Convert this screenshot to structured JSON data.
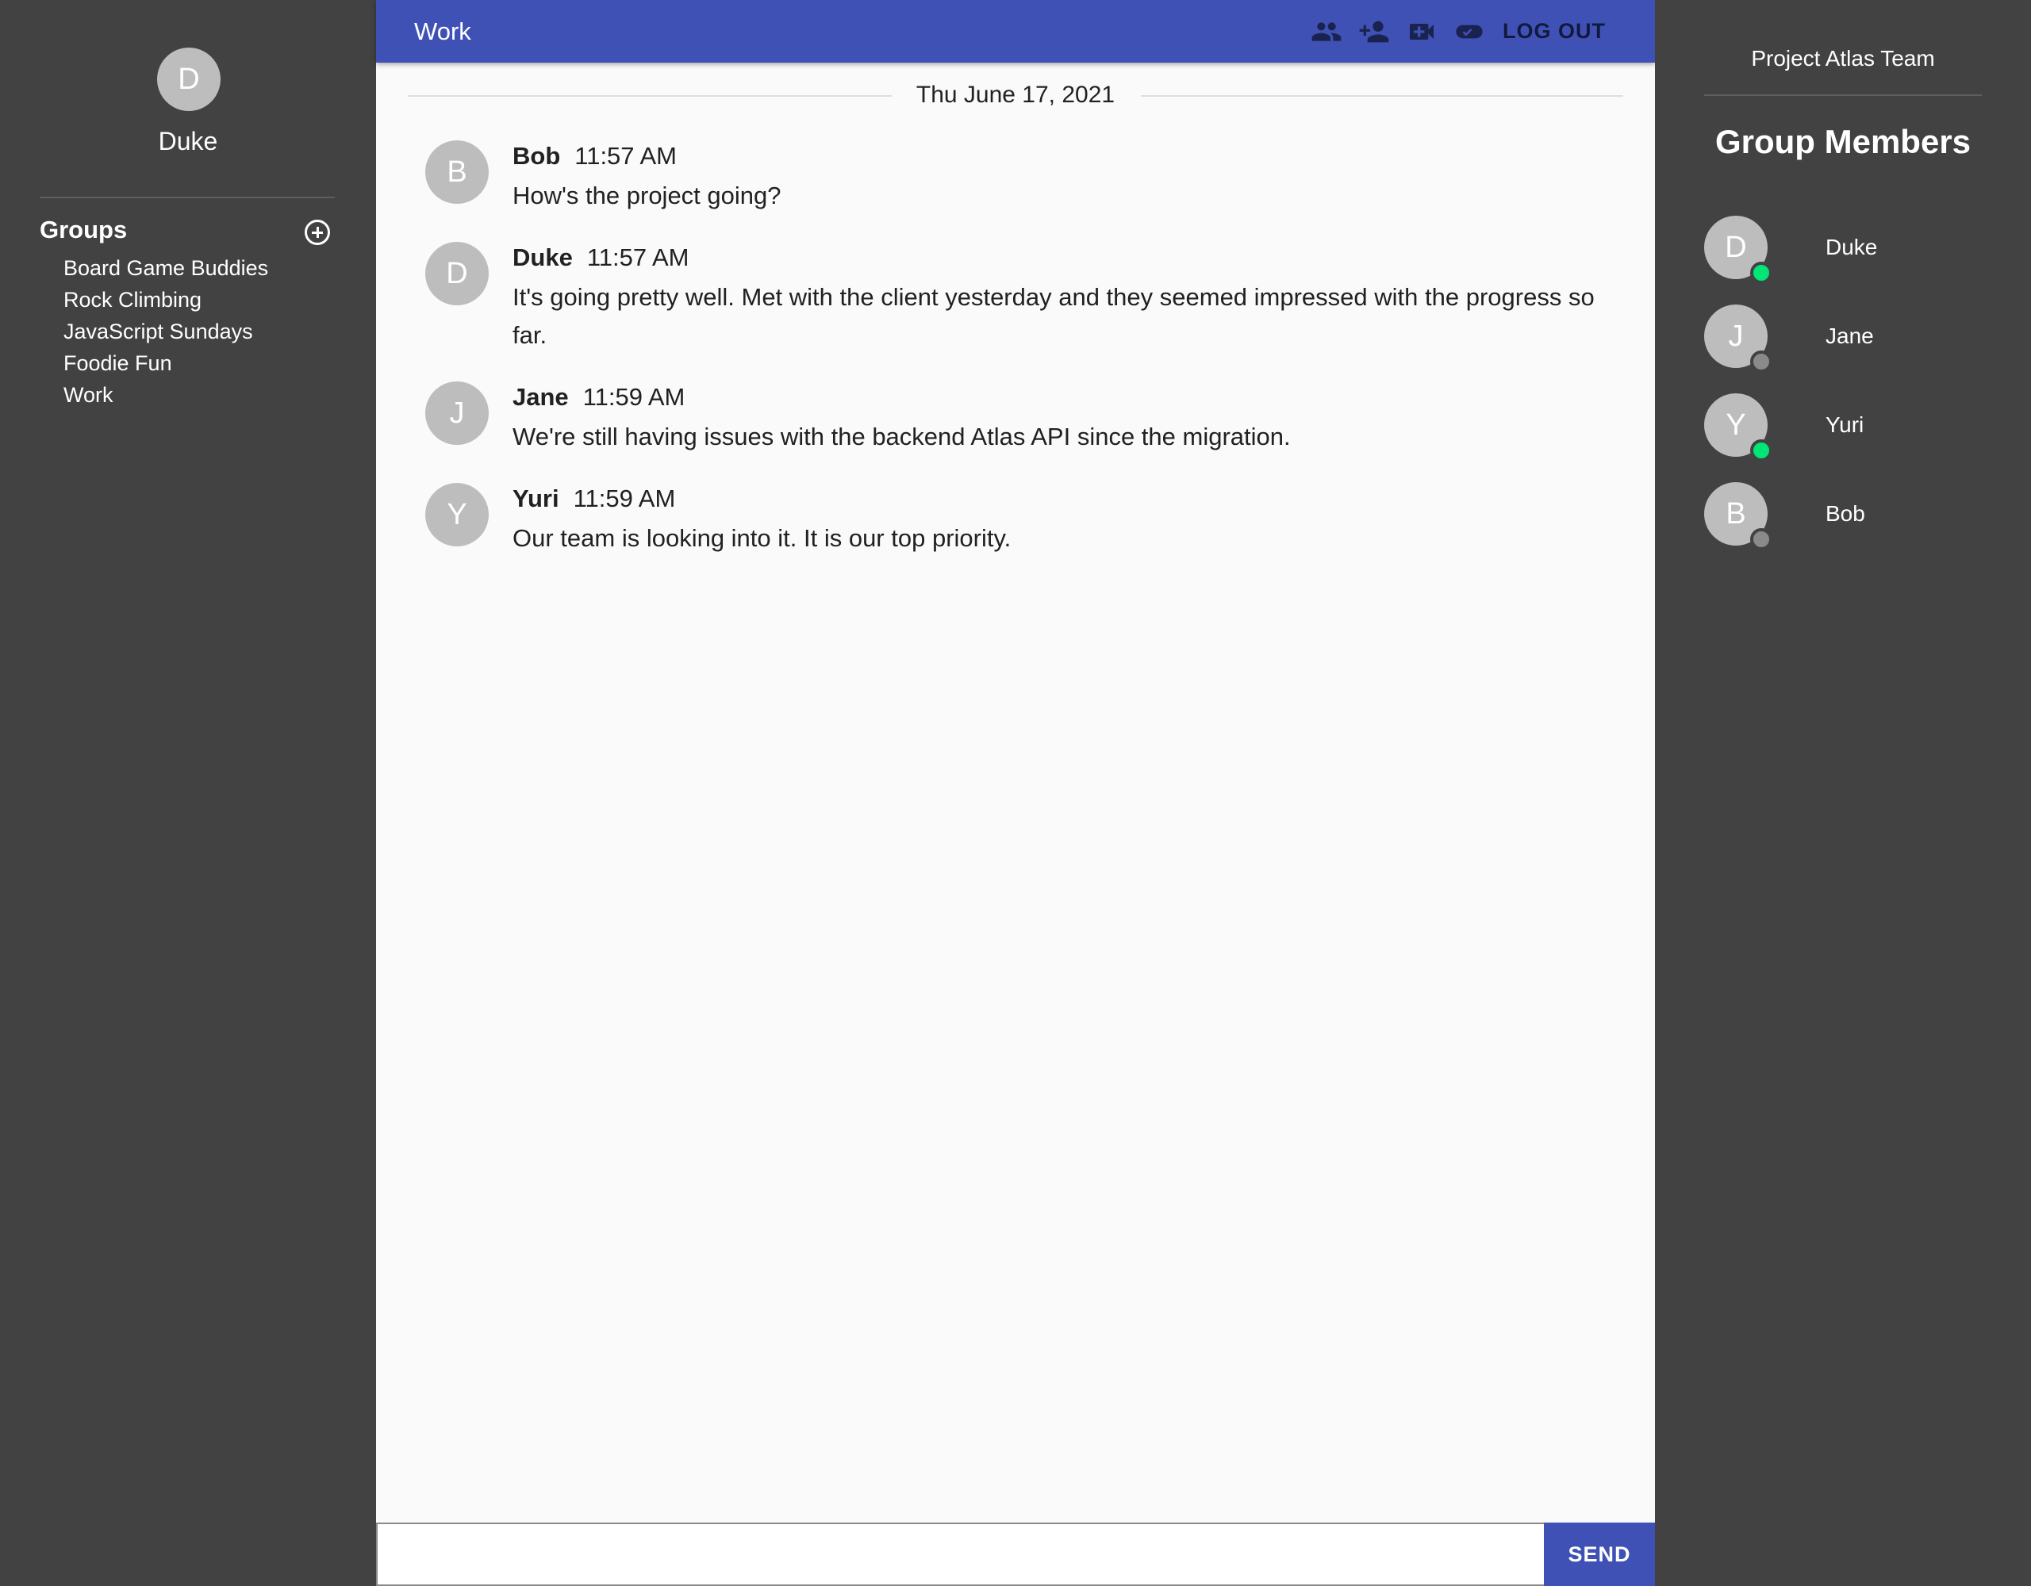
{
  "user": {
    "initial": "D",
    "name": "Duke"
  },
  "groups": {
    "heading": "Groups",
    "items": [
      "Board Game Buddies",
      "Rock Climbing",
      "JavaScript Sundays",
      "Foodie Fun",
      "Work"
    ]
  },
  "chat": {
    "title": "Work",
    "logout_label": "LOG OUT",
    "date": "Thu June 17, 2021",
    "messages": [
      {
        "initial": "B",
        "author": "Bob",
        "time": "11:57 AM",
        "text": "How's the project going?"
      },
      {
        "initial": "D",
        "author": "Duke",
        "time": "11:57 AM",
        "text": "It's going pretty well. Met with the client yesterday and they seemed impressed with the progress so far."
      },
      {
        "initial": "J",
        "author": "Jane",
        "time": "11:59 AM",
        "text": "We're still having issues with the backend Atlas API since the migration."
      },
      {
        "initial": "Y",
        "author": "Yuri",
        "time": "11:59 AM",
        "text": "Our team is looking into it. It is our top priority."
      }
    ],
    "composer": {
      "value": "",
      "placeholder": ""
    },
    "send_label": "SEND"
  },
  "toolbar_icons": [
    "group-icon",
    "add-person-icon",
    "video-call-icon",
    "toggle-icon"
  ],
  "team": {
    "name": "Project Atlas Team",
    "members_heading": "Group Members",
    "members": [
      {
        "initial": "D",
        "name": "Duke",
        "status": "online"
      },
      {
        "initial": "J",
        "name": "Jane",
        "status": "offline"
      },
      {
        "initial": "Y",
        "name": "Yuri",
        "status": "online"
      },
      {
        "initial": "B",
        "name": "Bob",
        "status": "offline"
      }
    ]
  },
  "colors": {
    "primary": "#3f51b5",
    "sidebar_bg": "#424242",
    "avatar_bg": "#bdbdbd",
    "online": "#00e676",
    "offline": "#8a8a8a",
    "toolbar_icon": "#1a2350"
  }
}
